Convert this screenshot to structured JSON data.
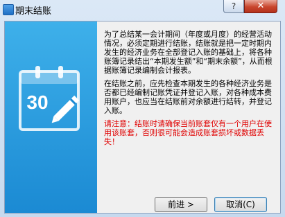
{
  "window": {
    "title": "期末结账",
    "help_label": "?",
    "close_label": "✕"
  },
  "side_panel": {
    "calendar_day": "30",
    "icon_name": "calendar-edit-icon"
  },
  "content": {
    "paragraph1": "为了总结某一会计期间（年度或月度）的经营活动情况，必须定期进行结账，结账就是把一定时期内发生的经济业务在全部登记入账的基础上，将各种账簿记录结出“本期发生额”和“期末余额”，从而根据账簿记录编制会计报表。",
    "paragraph2": "在结账之前，应先检查本期发生的各种经济业务是否都已经编制记账凭证并登记入账，对各种成本费用账户，也应当在结账前对余额进行结转，并登记入账。",
    "warning": "请注意：结账时请确保当前账套仅有一个用户在使用该账套，否则很可能会造成账套损坏或数据丢失！"
  },
  "buttons": {
    "next_label": "前进 >",
    "cancel_label": "取消(C)"
  },
  "colors": {
    "panel_top": "#3eb0ea",
    "panel_bottom": "#1b8ad3",
    "warning_text": "#e00000",
    "close_button": "#c9462d"
  }
}
